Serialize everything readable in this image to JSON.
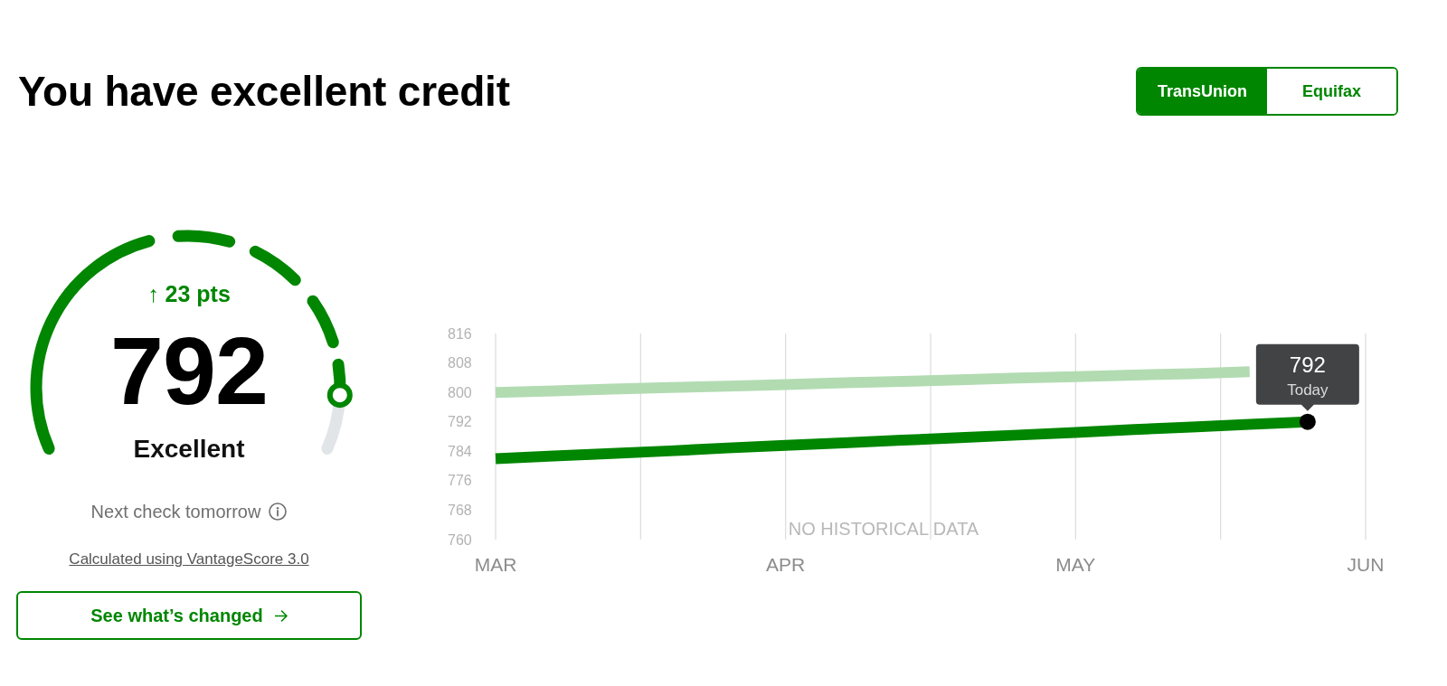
{
  "header": {
    "title": "You have excellent credit"
  },
  "bureaus": [
    {
      "label": "TransUnion",
      "selected": true
    },
    {
      "label": "Equifax",
      "selected": false
    }
  ],
  "gauge": {
    "level": 0.9,
    "change": "↑ 23 pts",
    "score": "792",
    "rating": "Excellent"
  },
  "next_check": "Next check tomorrow",
  "score_model_link": "Calculated using VantageScore 3.0",
  "changes_button": {
    "label": "See what’s changed"
  },
  "chart": {
    "chart_data": {
      "type": "line",
      "grid": true,
      "categories": [
        "MAR",
        null,
        null,
        null,
        null,
        "APR",
        null,
        null,
        null,
        null,
        "MAY",
        null,
        null,
        null,
        null,
        "JUN"
      ],
      "ylim": [
        760,
        816
      ],
      "yticks": [
        760,
        768,
        776,
        784,
        792,
        800,
        808,
        816
      ],
      "series": [
        {
          "color": "#008600",
          "values": [
            782,
            782.7,
            783.4,
            784.1,
            784.9,
            785.6,
            786.3,
            787,
            787.7,
            788.4,
            789.1,
            789.9,
            790.6,
            791.3,
            792,
            null
          ]
        },
        {
          "color": "#b2dbb2",
          "values": [
            800,
            800.4,
            800.9,
            801.3,
            801.7,
            802.1,
            802.6,
            803,
            803.4,
            803.9,
            804.3,
            804.7,
            805.1,
            805.6,
            null,
            null
          ]
        }
      ]
    },
    "note": "NO HISTORICAL DATA",
    "tooltip": {
      "value": "792",
      "label": "Today"
    }
  }
}
